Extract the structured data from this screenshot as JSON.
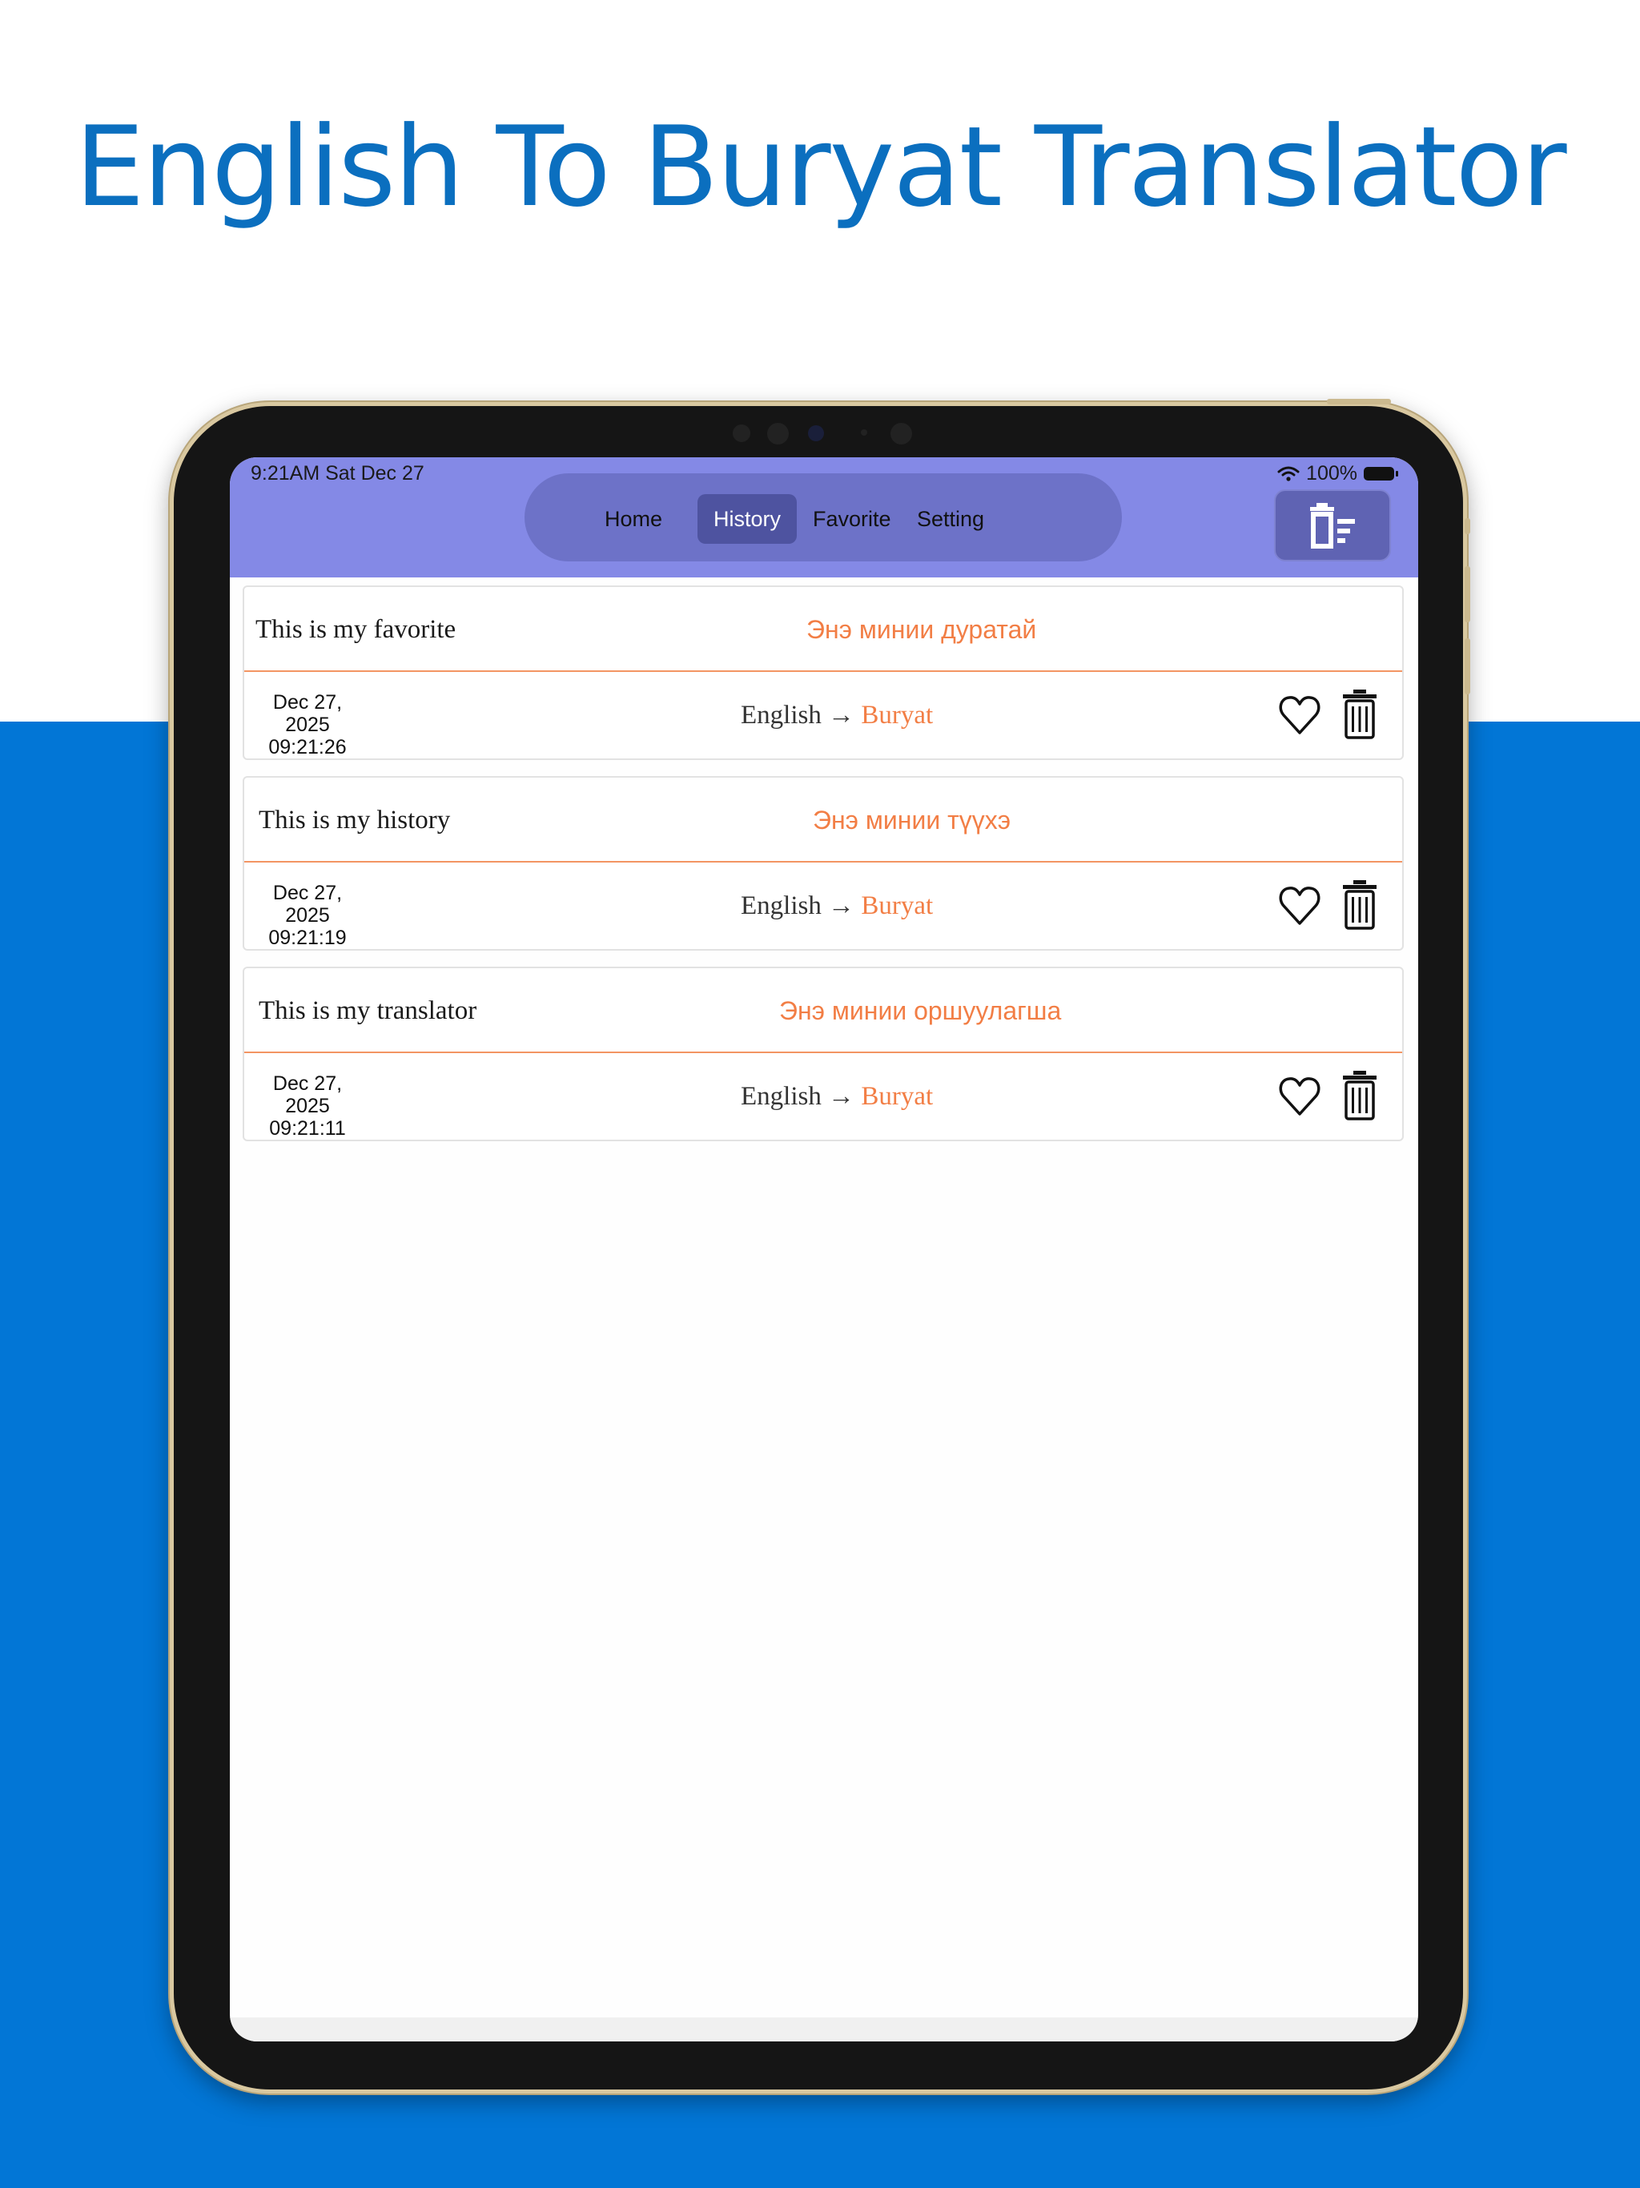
{
  "headline": "English To Buryat Translator",
  "status": {
    "time": "9:21AM  Sat Dec 27",
    "battery": "100%"
  },
  "nav": {
    "tabs": [
      {
        "label": "Home",
        "active": false
      },
      {
        "label": "History",
        "active": true
      },
      {
        "label": "Favorite",
        "active": false
      },
      {
        "label": "Setting",
        "active": false
      }
    ],
    "clear_icon": "delete-all-icon"
  },
  "history": [
    {
      "source": "This is my favorite",
      "translation": "Энэ минии дуратай",
      "date": "Dec 27, 2025",
      "time": "09:21:26",
      "from_lang": "English",
      "arrow": "→",
      "to_lang": "Buryat"
    },
    {
      "source": "This is my history",
      "translation": "Энэ минии түүхэ",
      "date": "Dec 27, 2025",
      "time": "09:21:19",
      "from_lang": "English",
      "arrow": "→",
      "to_lang": "Buryat"
    },
    {
      "source": "This is my translator",
      "translation": "Энэ минии оршуулагша",
      "date": "Dec 27, 2025",
      "time": "09:21:11",
      "from_lang": "English",
      "arrow": "→",
      "to_lang": "Buryat"
    }
  ],
  "colors": {
    "accent_orange": "#f27e45",
    "nav_bar": "#8489e6",
    "background_blue": "#0276d6",
    "headline_blue": "#0b6fbf"
  }
}
